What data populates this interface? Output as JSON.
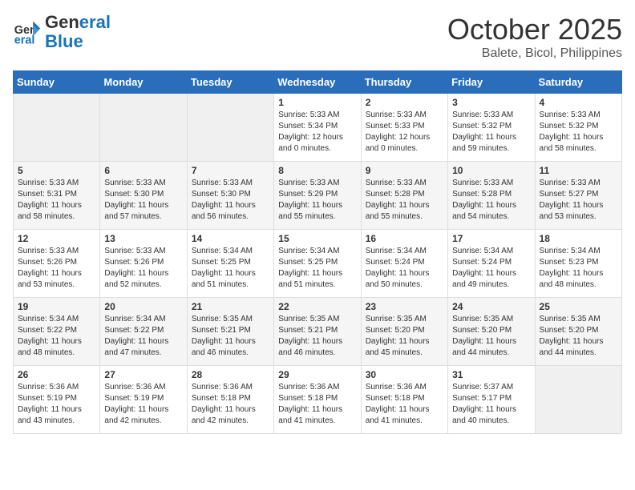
{
  "header": {
    "logo_line1": "General",
    "logo_line2": "Blue",
    "month": "October 2025",
    "location": "Balete, Bicol, Philippines"
  },
  "days_of_week": [
    "Sunday",
    "Monday",
    "Tuesday",
    "Wednesday",
    "Thursday",
    "Friday",
    "Saturday"
  ],
  "weeks": [
    [
      {
        "day": "",
        "info": ""
      },
      {
        "day": "",
        "info": ""
      },
      {
        "day": "",
        "info": ""
      },
      {
        "day": "1",
        "info": "Sunrise: 5:33 AM\nSunset: 5:34 PM\nDaylight: 12 hours\nand 0 minutes."
      },
      {
        "day": "2",
        "info": "Sunrise: 5:33 AM\nSunset: 5:33 PM\nDaylight: 12 hours\nand 0 minutes."
      },
      {
        "day": "3",
        "info": "Sunrise: 5:33 AM\nSunset: 5:32 PM\nDaylight: 11 hours\nand 59 minutes."
      },
      {
        "day": "4",
        "info": "Sunrise: 5:33 AM\nSunset: 5:32 PM\nDaylight: 11 hours\nand 58 minutes."
      }
    ],
    [
      {
        "day": "5",
        "info": "Sunrise: 5:33 AM\nSunset: 5:31 PM\nDaylight: 11 hours\nand 58 minutes."
      },
      {
        "day": "6",
        "info": "Sunrise: 5:33 AM\nSunset: 5:30 PM\nDaylight: 11 hours\nand 57 minutes."
      },
      {
        "day": "7",
        "info": "Sunrise: 5:33 AM\nSunset: 5:30 PM\nDaylight: 11 hours\nand 56 minutes."
      },
      {
        "day": "8",
        "info": "Sunrise: 5:33 AM\nSunset: 5:29 PM\nDaylight: 11 hours\nand 55 minutes."
      },
      {
        "day": "9",
        "info": "Sunrise: 5:33 AM\nSunset: 5:28 PM\nDaylight: 11 hours\nand 55 minutes."
      },
      {
        "day": "10",
        "info": "Sunrise: 5:33 AM\nSunset: 5:28 PM\nDaylight: 11 hours\nand 54 minutes."
      },
      {
        "day": "11",
        "info": "Sunrise: 5:33 AM\nSunset: 5:27 PM\nDaylight: 11 hours\nand 53 minutes."
      }
    ],
    [
      {
        "day": "12",
        "info": "Sunrise: 5:33 AM\nSunset: 5:26 PM\nDaylight: 11 hours\nand 53 minutes."
      },
      {
        "day": "13",
        "info": "Sunrise: 5:33 AM\nSunset: 5:26 PM\nDaylight: 11 hours\nand 52 minutes."
      },
      {
        "day": "14",
        "info": "Sunrise: 5:34 AM\nSunset: 5:25 PM\nDaylight: 11 hours\nand 51 minutes."
      },
      {
        "day": "15",
        "info": "Sunrise: 5:34 AM\nSunset: 5:25 PM\nDaylight: 11 hours\nand 51 minutes."
      },
      {
        "day": "16",
        "info": "Sunrise: 5:34 AM\nSunset: 5:24 PM\nDaylight: 11 hours\nand 50 minutes."
      },
      {
        "day": "17",
        "info": "Sunrise: 5:34 AM\nSunset: 5:24 PM\nDaylight: 11 hours\nand 49 minutes."
      },
      {
        "day": "18",
        "info": "Sunrise: 5:34 AM\nSunset: 5:23 PM\nDaylight: 11 hours\nand 48 minutes."
      }
    ],
    [
      {
        "day": "19",
        "info": "Sunrise: 5:34 AM\nSunset: 5:22 PM\nDaylight: 11 hours\nand 48 minutes."
      },
      {
        "day": "20",
        "info": "Sunrise: 5:34 AM\nSunset: 5:22 PM\nDaylight: 11 hours\nand 47 minutes."
      },
      {
        "day": "21",
        "info": "Sunrise: 5:35 AM\nSunset: 5:21 PM\nDaylight: 11 hours\nand 46 minutes."
      },
      {
        "day": "22",
        "info": "Sunrise: 5:35 AM\nSunset: 5:21 PM\nDaylight: 11 hours\nand 46 minutes."
      },
      {
        "day": "23",
        "info": "Sunrise: 5:35 AM\nSunset: 5:20 PM\nDaylight: 11 hours\nand 45 minutes."
      },
      {
        "day": "24",
        "info": "Sunrise: 5:35 AM\nSunset: 5:20 PM\nDaylight: 11 hours\nand 44 minutes."
      },
      {
        "day": "25",
        "info": "Sunrise: 5:35 AM\nSunset: 5:20 PM\nDaylight: 11 hours\nand 44 minutes."
      }
    ],
    [
      {
        "day": "26",
        "info": "Sunrise: 5:36 AM\nSunset: 5:19 PM\nDaylight: 11 hours\nand 43 minutes."
      },
      {
        "day": "27",
        "info": "Sunrise: 5:36 AM\nSunset: 5:19 PM\nDaylight: 11 hours\nand 42 minutes."
      },
      {
        "day": "28",
        "info": "Sunrise: 5:36 AM\nSunset: 5:18 PM\nDaylight: 11 hours\nand 42 minutes."
      },
      {
        "day": "29",
        "info": "Sunrise: 5:36 AM\nSunset: 5:18 PM\nDaylight: 11 hours\nand 41 minutes."
      },
      {
        "day": "30",
        "info": "Sunrise: 5:36 AM\nSunset: 5:18 PM\nDaylight: 11 hours\nand 41 minutes."
      },
      {
        "day": "31",
        "info": "Sunrise: 5:37 AM\nSunset: 5:17 PM\nDaylight: 11 hours\nand 40 minutes."
      },
      {
        "day": "",
        "info": ""
      }
    ]
  ]
}
